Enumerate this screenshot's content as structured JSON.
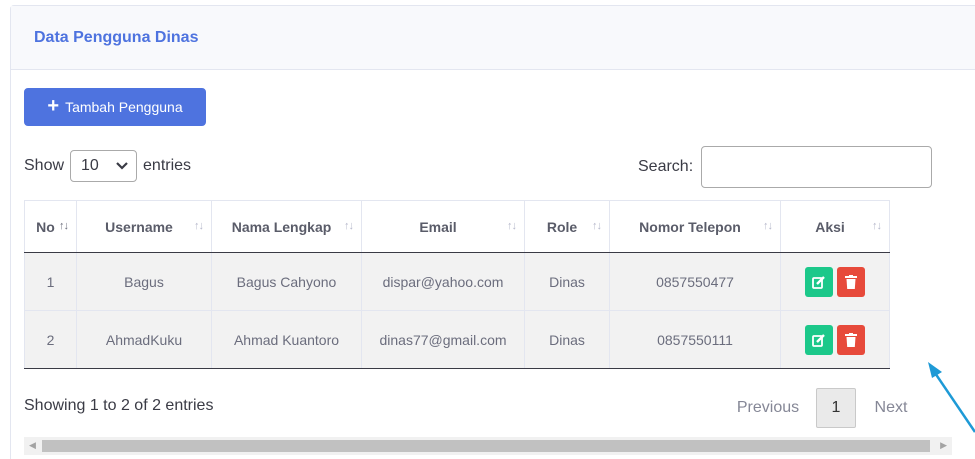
{
  "header": {
    "title": "Data Pengguna Dinas"
  },
  "toolbar": {
    "add_label": "Tambah Pengguna"
  },
  "length": {
    "show": "Show",
    "value": "10",
    "entries": "entries"
  },
  "search": {
    "label": "Search:",
    "value": ""
  },
  "table": {
    "columns": [
      "No",
      "Username",
      "Nama Lengkap",
      "Email",
      "Role",
      "Nomor Telepon",
      "Aksi"
    ],
    "rows": [
      [
        "1",
        "Bagus",
        "Bagus Cahyono",
        "dispar@yahoo.com",
        "Dinas",
        "0857550477"
      ],
      [
        "2",
        "AhmadKuku",
        "Ahmad Kuantoro",
        "dinas77@gmail.com",
        "Dinas",
        "0857550111"
      ]
    ]
  },
  "footer": {
    "info": "Showing 1 to 2 of 2 entries"
  },
  "pagination": {
    "previous": "Previous",
    "page": "1",
    "next": "Next"
  },
  "colors": {
    "primary": "#4e73df",
    "success": "#1cc88a",
    "danger": "#e74a3b",
    "pointer": "#1e9ad6"
  },
  "icons": {
    "add": "plus-icon",
    "edit": "edit-icon",
    "delete": "trash-icon",
    "sort": "sort-icon"
  }
}
